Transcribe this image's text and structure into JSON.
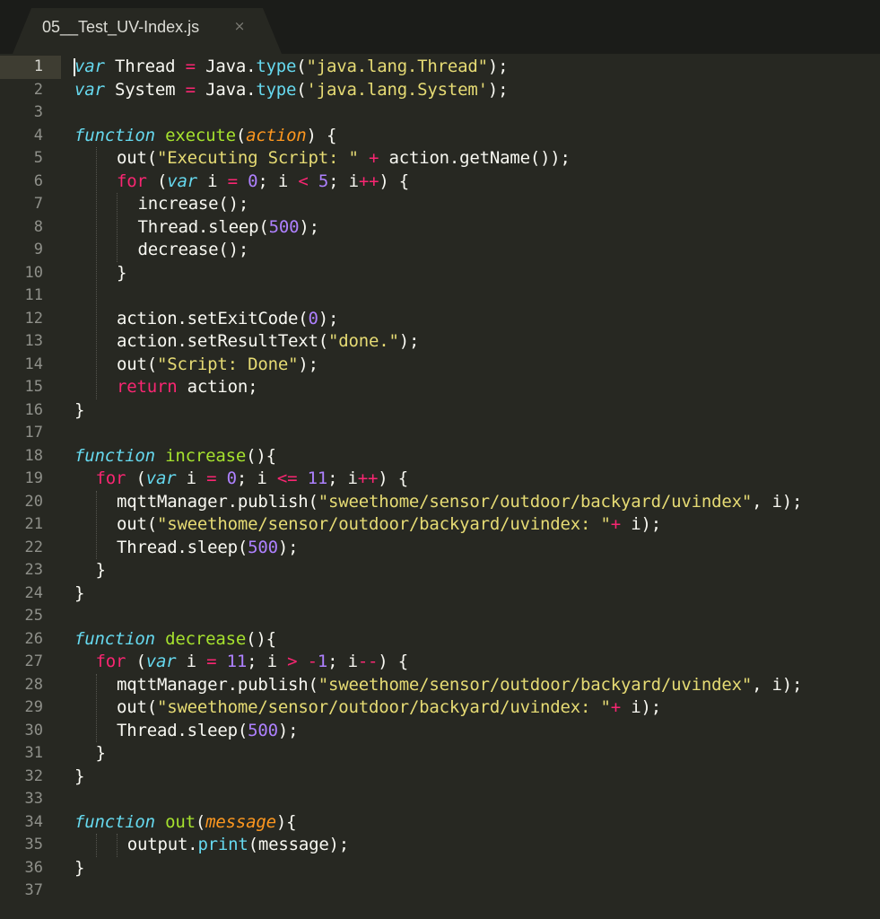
{
  "tab": {
    "title": "05__Test_UV-Index.js",
    "close_glyph": "×"
  },
  "colors": {
    "background": "#272822",
    "tabbar": "#1b1c19",
    "keyword": "#f92672",
    "string": "#e6db74",
    "number": "#ae81ff",
    "function_name": "#a6e22e",
    "storage": "#66d9ef",
    "parameter": "#fd971f",
    "text": "#f8f8f2",
    "line_number": "#8f908a"
  },
  "current_line": 1,
  "lines": [
    {
      "n": "1",
      "indent": 0,
      "tokens": [
        [
          "st",
          "var"
        ],
        [
          "t",
          " Thread "
        ],
        [
          "k",
          "="
        ],
        [
          "t",
          " Java."
        ],
        [
          "c",
          "type"
        ],
        [
          "t",
          "("
        ],
        [
          "s",
          "\"java.lang.Thread\""
        ],
        [
          "t",
          ");"
        ]
      ]
    },
    {
      "n": "2",
      "indent": 0,
      "tokens": [
        [
          "st",
          "var"
        ],
        [
          "t",
          " System "
        ],
        [
          "k",
          "="
        ],
        [
          "t",
          " Java."
        ],
        [
          "c",
          "type"
        ],
        [
          "t",
          "("
        ],
        [
          "s",
          "'java.lang.System'"
        ],
        [
          "t",
          ");"
        ]
      ]
    },
    {
      "n": "3",
      "indent": 0,
      "tokens": []
    },
    {
      "n": "4",
      "indent": 0,
      "tokens": [
        [
          "st",
          "function"
        ],
        [
          "t",
          " "
        ],
        [
          "f",
          "execute"
        ],
        [
          "t",
          "("
        ],
        [
          "p",
          "action"
        ],
        [
          "t",
          ") {"
        ]
      ]
    },
    {
      "n": "5",
      "indent": 4,
      "tokens": [
        [
          "t",
          "out("
        ],
        [
          "s",
          "\"Executing Script: \""
        ],
        [
          "t",
          " "
        ],
        [
          "k",
          "+"
        ],
        [
          "t",
          " action.getName());"
        ]
      ]
    },
    {
      "n": "6",
      "indent": 4,
      "tokens": [
        [
          "k",
          "for"
        ],
        [
          "t",
          " ("
        ],
        [
          "st",
          "var"
        ],
        [
          "t",
          " i "
        ],
        [
          "k",
          "="
        ],
        [
          "t",
          " "
        ],
        [
          "n",
          "0"
        ],
        [
          "t",
          "; i "
        ],
        [
          "k",
          "<"
        ],
        [
          "t",
          " "
        ],
        [
          "n",
          "5"
        ],
        [
          "t",
          "; i"
        ],
        [
          "k",
          "++"
        ],
        [
          "t",
          ") {"
        ]
      ]
    },
    {
      "n": "7",
      "indent": 6,
      "tokens": [
        [
          "t",
          "increase();"
        ]
      ]
    },
    {
      "n": "8",
      "indent": 6,
      "tokens": [
        [
          "t",
          "Thread.sleep("
        ],
        [
          "n",
          "500"
        ],
        [
          "t",
          ");"
        ]
      ]
    },
    {
      "n": "9",
      "indent": 6,
      "tokens": [
        [
          "t",
          "decrease();"
        ]
      ]
    },
    {
      "n": "10",
      "indent": 4,
      "tokens": [
        [
          "t",
          "}"
        ]
      ]
    },
    {
      "n": "11",
      "indent": 0,
      "tokens": []
    },
    {
      "n": "12",
      "indent": 4,
      "tokens": [
        [
          "t",
          "action.setExitCode("
        ],
        [
          "n",
          "0"
        ],
        [
          "t",
          ");"
        ]
      ]
    },
    {
      "n": "13",
      "indent": 4,
      "tokens": [
        [
          "t",
          "action.setResultText("
        ],
        [
          "s",
          "\"done.\""
        ],
        [
          "t",
          ");"
        ]
      ]
    },
    {
      "n": "14",
      "indent": 4,
      "tokens": [
        [
          "t",
          "out("
        ],
        [
          "s",
          "\"Script: Done\""
        ],
        [
          "t",
          ");"
        ]
      ]
    },
    {
      "n": "15",
      "indent": 4,
      "tokens": [
        [
          "k",
          "return"
        ],
        [
          "t",
          " action;"
        ]
      ]
    },
    {
      "n": "16",
      "indent": 0,
      "tokens": [
        [
          "t",
          "}"
        ]
      ]
    },
    {
      "n": "17",
      "indent": 0,
      "tokens": []
    },
    {
      "n": "18",
      "indent": 0,
      "tokens": [
        [
          "st",
          "function"
        ],
        [
          "t",
          " "
        ],
        [
          "f",
          "increase"
        ],
        [
          "t",
          "(){"
        ]
      ]
    },
    {
      "n": "19",
      "indent": 2,
      "tokens": [
        [
          "k",
          "for"
        ],
        [
          "t",
          " ("
        ],
        [
          "st",
          "var"
        ],
        [
          "t",
          " i "
        ],
        [
          "k",
          "="
        ],
        [
          "t",
          " "
        ],
        [
          "n",
          "0"
        ],
        [
          "t",
          "; i "
        ],
        [
          "k",
          "<="
        ],
        [
          "t",
          " "
        ],
        [
          "n",
          "11"
        ],
        [
          "t",
          "; i"
        ],
        [
          "k",
          "++"
        ],
        [
          "t",
          ") {"
        ]
      ]
    },
    {
      "n": "20",
      "indent": 4,
      "tokens": [
        [
          "t",
          "mqttManager.publish("
        ],
        [
          "s",
          "\"sweethome/sensor/outdoor/backyard/uvindex\""
        ],
        [
          "t",
          ", i);"
        ]
      ]
    },
    {
      "n": "21",
      "indent": 4,
      "tokens": [
        [
          "t",
          "out("
        ],
        [
          "s",
          "\"sweethome/sensor/outdoor/backyard/uvindex: \""
        ],
        [
          "k",
          "+"
        ],
        [
          "t",
          " i);"
        ]
      ]
    },
    {
      "n": "22",
      "indent": 4,
      "tokens": [
        [
          "t",
          "Thread.sleep("
        ],
        [
          "n",
          "500"
        ],
        [
          "t",
          ");"
        ]
      ]
    },
    {
      "n": "23",
      "indent": 2,
      "tokens": [
        [
          "t",
          "}"
        ]
      ]
    },
    {
      "n": "24",
      "indent": 0,
      "tokens": [
        [
          "t",
          "}"
        ]
      ]
    },
    {
      "n": "25",
      "indent": 0,
      "tokens": []
    },
    {
      "n": "26",
      "indent": 0,
      "tokens": [
        [
          "st",
          "function"
        ],
        [
          "t",
          " "
        ],
        [
          "f",
          "decrease"
        ],
        [
          "t",
          "(){"
        ]
      ]
    },
    {
      "n": "27",
      "indent": 2,
      "tokens": [
        [
          "k",
          "for"
        ],
        [
          "t",
          " ("
        ],
        [
          "st",
          "var"
        ],
        [
          "t",
          " i "
        ],
        [
          "k",
          "="
        ],
        [
          "t",
          " "
        ],
        [
          "n",
          "11"
        ],
        [
          "t",
          "; i "
        ],
        [
          "k",
          ">"
        ],
        [
          "t",
          " "
        ],
        [
          "k",
          "-"
        ],
        [
          "n",
          "1"
        ],
        [
          "t",
          "; i"
        ],
        [
          "k",
          "--"
        ],
        [
          "t",
          ") {"
        ]
      ]
    },
    {
      "n": "28",
      "indent": 4,
      "tokens": [
        [
          "t",
          "mqttManager.publish("
        ],
        [
          "s",
          "\"sweethome/sensor/outdoor/backyard/uvindex\""
        ],
        [
          "t",
          ", i);"
        ]
      ]
    },
    {
      "n": "29",
      "indent": 4,
      "tokens": [
        [
          "t",
          "out("
        ],
        [
          "s",
          "\"sweethome/sensor/outdoor/backyard/uvindex: \""
        ],
        [
          "k",
          "+"
        ],
        [
          "t",
          " i);"
        ]
      ]
    },
    {
      "n": "30",
      "indent": 4,
      "tokens": [
        [
          "t",
          "Thread.sleep("
        ],
        [
          "n",
          "500"
        ],
        [
          "t",
          ");"
        ]
      ]
    },
    {
      "n": "31",
      "indent": 2,
      "tokens": [
        [
          "t",
          "}"
        ]
      ]
    },
    {
      "n": "32",
      "indent": 0,
      "tokens": [
        [
          "t",
          "}"
        ]
      ]
    },
    {
      "n": "33",
      "indent": 0,
      "tokens": []
    },
    {
      "n": "34",
      "indent": 0,
      "tokens": [
        [
          "st",
          "function"
        ],
        [
          "t",
          " "
        ],
        [
          "f",
          "out"
        ],
        [
          "t",
          "("
        ],
        [
          "p",
          "message"
        ],
        [
          "t",
          "){"
        ]
      ]
    },
    {
      "n": "35",
      "indent": 5,
      "tokens": [
        [
          "t",
          "output."
        ],
        [
          "c",
          "print"
        ],
        [
          "t",
          "(message);"
        ]
      ]
    },
    {
      "n": "36",
      "indent": 0,
      "tokens": [
        [
          "t",
          "}"
        ]
      ]
    },
    {
      "n": "37",
      "indent": 0,
      "tokens": []
    }
  ]
}
